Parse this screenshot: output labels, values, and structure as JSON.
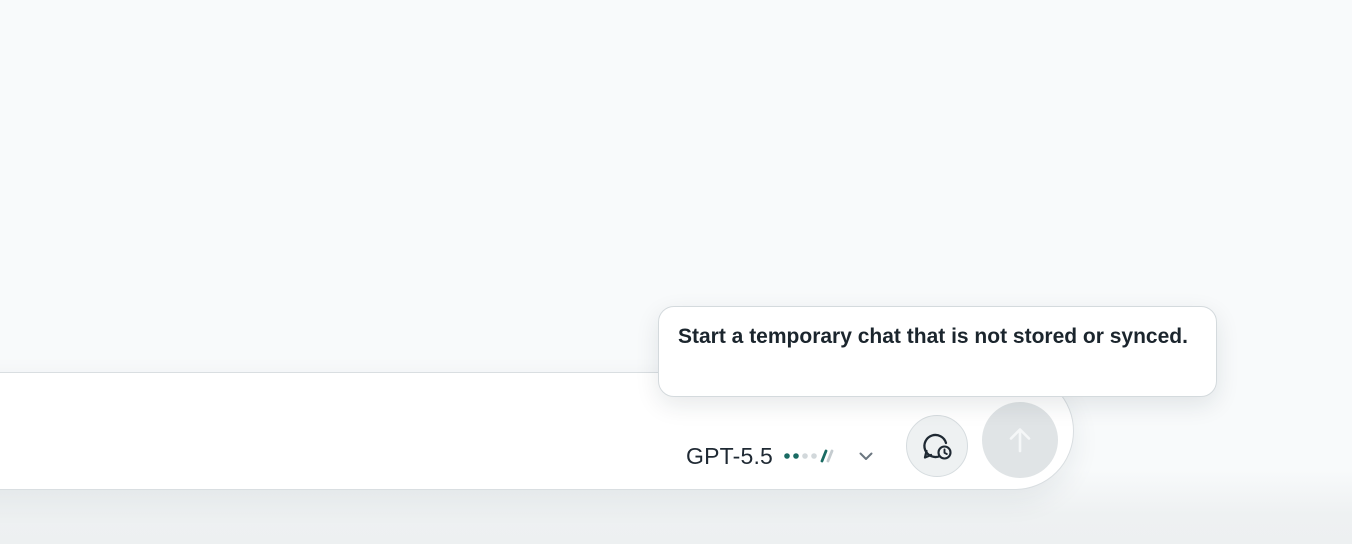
{
  "composer": {
    "model_name": "GPT-5.5",
    "tooltip_text": "Start a temporary chat that is not stored or synced."
  },
  "icons": {
    "chevron": "chevron-down-icon",
    "temp_chat": "temporary-chat-icon",
    "send": "arrow-up-icon",
    "level": "reasoning-level-icon"
  },
  "colors": {
    "accent": "#1a6b63",
    "send_disabled_bg": "#e0e4e6",
    "send_disabled_icon": "#f5f7f8"
  }
}
